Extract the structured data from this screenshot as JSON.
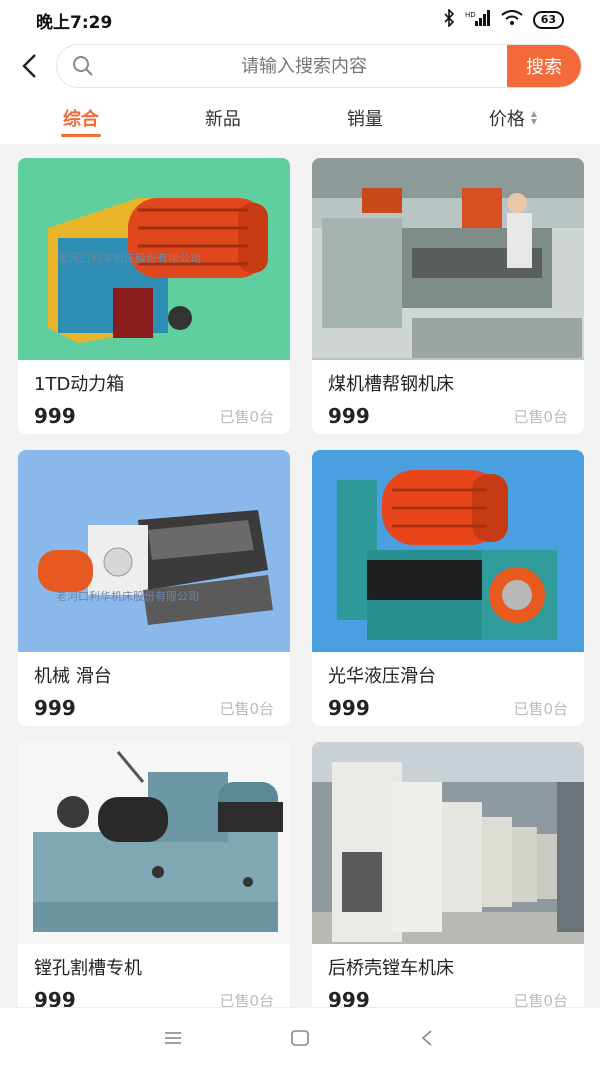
{
  "status": {
    "time": "晚上7:29",
    "battery": "63",
    "network": "HD"
  },
  "search": {
    "placeholder": "请输入搜索内容",
    "button": "搜索"
  },
  "tabs": [
    {
      "label": "综合",
      "active": true
    },
    {
      "label": "新品",
      "active": false
    },
    {
      "label": "销量",
      "active": false
    },
    {
      "label": "价格",
      "active": false
    }
  ],
  "products": [
    {
      "title": "1TD动力箱",
      "price": "999",
      "sold": "已售0台",
      "watermark": "老河口利华机床股份有限公司"
    },
    {
      "title": "煤机槽帮钢机床",
      "price": "999",
      "sold": "已售0台"
    },
    {
      "title": "机械 滑台",
      "price": "999",
      "sold": "已售0台",
      "watermark": "老河口利华机床股份有限公司"
    },
    {
      "title": "光华液压滑台",
      "price": "999",
      "sold": "已售0台"
    },
    {
      "title": "镗孔割槽专机",
      "price": "999",
      "sold": "已售0台"
    },
    {
      "title": "后桥壳镗车机床",
      "price": "999",
      "sold": "已售0台"
    }
  ],
  "colors": {
    "accent": "#f46a3a",
    "background": "#f2f2f2"
  },
  "nav": {
    "icons": [
      "menu-icon",
      "home-square-icon",
      "back-triangle-icon"
    ]
  }
}
